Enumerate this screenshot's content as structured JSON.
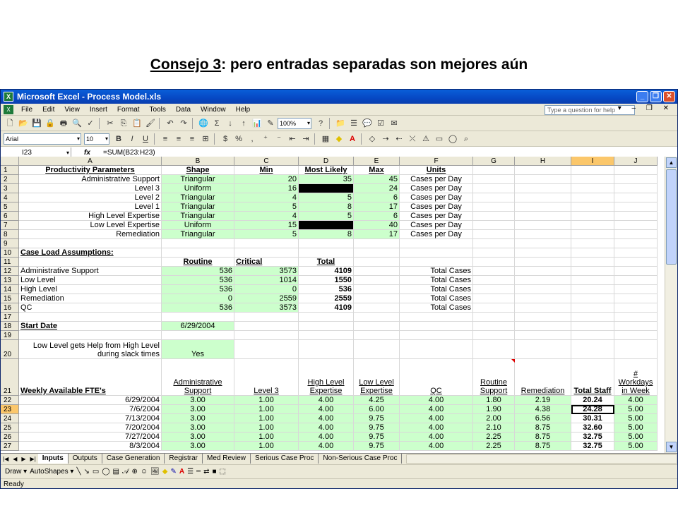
{
  "slide": {
    "title_underlined": "Consejo 3",
    "title_rest": ": pero entradas separadas son mejores aún"
  },
  "window": {
    "title": "Microsoft Excel - Process Model.xls"
  },
  "menu": [
    "File",
    "Edit",
    "View",
    "Insert",
    "Format",
    "Tools",
    "Data",
    "Window",
    "Help"
  ],
  "ask_placeholder": "Type a question for help",
  "toolbar": {
    "zoom": "100%",
    "font": "Arial",
    "size": "10"
  },
  "formula_bar": {
    "name_box": "I23",
    "fx": "fx",
    "formula": "=SUM(B23:H23)"
  },
  "columns": [
    {
      "name": "A",
      "w": 202
    },
    {
      "name": "B",
      "w": 103
    },
    {
      "name": "C",
      "w": 91
    },
    {
      "name": "D",
      "w": 78
    },
    {
      "name": "E",
      "w": 65
    },
    {
      "name": "F",
      "w": 104
    },
    {
      "name": "G",
      "w": 59
    },
    {
      "name": "H",
      "w": 80
    },
    {
      "name": "I",
      "w": 61
    },
    {
      "name": "J",
      "w": 61
    }
  ],
  "selected_col": "I",
  "rows": [
    {
      "n": "1",
      "h": 13,
      "cells": {
        "A": {
          "v": "Productivity Parameters",
          "a": "c",
          "s": "bu"
        },
        "B": {
          "v": "Shape",
          "a": "c",
          "s": "bu"
        },
        "C": {
          "v": "Min",
          "a": "c",
          "s": "bu"
        },
        "D": {
          "v": "Most Likely",
          "a": "c",
          "s": "bu"
        },
        "E": {
          "v": "Max",
          "a": "c",
          "s": "bu"
        },
        "F": {
          "v": "Units",
          "a": "c",
          "s": "bu"
        }
      }
    },
    {
      "n": "2",
      "h": 13,
      "cells": {
        "A": {
          "v": "Administrative Support",
          "a": "r"
        },
        "B": {
          "v": "Triangular",
          "a": "c",
          "g": 1
        },
        "C": {
          "v": "20",
          "a": "r",
          "g": 1
        },
        "D": {
          "v": "35",
          "a": "r",
          "g": 1
        },
        "E": {
          "v": "45",
          "a": "r",
          "g": 1
        },
        "F": {
          "v": "Cases per Day",
          "a": "c"
        }
      }
    },
    {
      "n": "3",
      "h": 13,
      "cells": {
        "A": {
          "v": "Level 3",
          "a": "r"
        },
        "B": {
          "v": "Uniform",
          "a": "c",
          "g": 1
        },
        "C": {
          "v": "16",
          "a": "r",
          "g": 1
        },
        "D": {
          "v": "",
          "k": 1
        },
        "E": {
          "v": "24",
          "a": "r",
          "g": 1
        },
        "F": {
          "v": "Cases per Day",
          "a": "c"
        }
      }
    },
    {
      "n": "4",
      "h": 13,
      "cells": {
        "A": {
          "v": "Level 2",
          "a": "r"
        },
        "B": {
          "v": "Triangular",
          "a": "c",
          "g": 1
        },
        "C": {
          "v": "4",
          "a": "r",
          "g": 1
        },
        "D": {
          "v": "5",
          "a": "r",
          "g": 1
        },
        "E": {
          "v": "6",
          "a": "r",
          "g": 1
        },
        "F": {
          "v": "Cases per Day",
          "a": "c"
        }
      }
    },
    {
      "n": "5",
      "h": 13,
      "cells": {
        "A": {
          "v": "Level 1",
          "a": "r"
        },
        "B": {
          "v": "Triangular",
          "a": "c",
          "g": 1
        },
        "C": {
          "v": "5",
          "a": "r",
          "g": 1
        },
        "D": {
          "v": "8",
          "a": "r",
          "g": 1
        },
        "E": {
          "v": "17",
          "a": "r",
          "g": 1
        },
        "F": {
          "v": "Cases per Day",
          "a": "c"
        }
      }
    },
    {
      "n": "6",
      "h": 13,
      "cells": {
        "A": {
          "v": "High Level Expertise",
          "a": "r"
        },
        "B": {
          "v": "Triangular",
          "a": "c",
          "g": 1
        },
        "C": {
          "v": "4",
          "a": "r",
          "g": 1
        },
        "D": {
          "v": "5",
          "a": "r",
          "g": 1
        },
        "E": {
          "v": "6",
          "a": "r",
          "g": 1
        },
        "F": {
          "v": "Cases per Day",
          "a": "c"
        }
      }
    },
    {
      "n": "7",
      "h": 13,
      "cells": {
        "A": {
          "v": "Low Level Expertise",
          "a": "r"
        },
        "B": {
          "v": "Uniform",
          "a": "c",
          "g": 1
        },
        "C": {
          "v": "15",
          "a": "r",
          "g": 1
        },
        "D": {
          "v": "",
          "k": 1
        },
        "E": {
          "v": "40",
          "a": "r",
          "g": 1
        },
        "F": {
          "v": "Cases per Day",
          "a": "c"
        }
      }
    },
    {
      "n": "8",
      "h": 13,
      "cells": {
        "A": {
          "v": "Remediation",
          "a": "r"
        },
        "B": {
          "v": "Triangular",
          "a": "c",
          "g": 1
        },
        "C": {
          "v": "5",
          "a": "r",
          "g": 1
        },
        "D": {
          "v": "8",
          "a": "r",
          "g": 1
        },
        "E": {
          "v": "17",
          "a": "r",
          "g": 1
        },
        "F": {
          "v": "Cases per Day",
          "a": "c"
        }
      }
    },
    {
      "n": "9",
      "h": 13,
      "cells": {}
    },
    {
      "n": "10",
      "h": 13,
      "cells": {
        "A": {
          "v": "Case Load Assumptions:",
          "a": "l",
          "s": "bu"
        }
      }
    },
    {
      "n": "11",
      "h": 13,
      "cells": {
        "B": {
          "v": "Routine",
          "a": "c",
          "s": "bu"
        },
        "C": {
          "v": "Critical",
          "a": "l",
          "s": "bu"
        },
        "D": {
          "v": "Total",
          "a": "c",
          "s": "bu"
        }
      }
    },
    {
      "n": "12",
      "h": 13,
      "cells": {
        "A": {
          "v": "Administrative Support",
          "a": "l"
        },
        "B": {
          "v": "536",
          "a": "r",
          "g": 1
        },
        "C": {
          "v": "3573",
          "a": "r",
          "g": 1
        },
        "D": {
          "v": "4109",
          "a": "r",
          "s": "b"
        },
        "F": {
          "v": "Total Cases",
          "a": "r"
        }
      }
    },
    {
      "n": "13",
      "h": 13,
      "cells": {
        "A": {
          "v": "Low Level",
          "a": "l"
        },
        "B": {
          "v": "536",
          "a": "r",
          "g": 1
        },
        "C": {
          "v": "1014",
          "a": "r",
          "g": 1
        },
        "D": {
          "v": "1550",
          "a": "r",
          "s": "b"
        },
        "F": {
          "v": "Total Cases",
          "a": "r"
        }
      }
    },
    {
      "n": "14",
      "h": 13,
      "cells": {
        "A": {
          "v": "High Level",
          "a": "l"
        },
        "B": {
          "v": "536",
          "a": "r",
          "g": 1
        },
        "C": {
          "v": "0",
          "a": "r",
          "g": 1
        },
        "D": {
          "v": "536",
          "a": "r",
          "s": "b"
        },
        "F": {
          "v": "Total Cases",
          "a": "r"
        }
      }
    },
    {
      "n": "15",
      "h": 13,
      "cells": {
        "A": {
          "v": "Remediation",
          "a": "l"
        },
        "B": {
          "v": "0",
          "a": "r",
          "g": 1
        },
        "C": {
          "v": "2559",
          "a": "r",
          "g": 1
        },
        "D": {
          "v": "2559",
          "a": "r",
          "s": "b"
        },
        "F": {
          "v": "Total Cases",
          "a": "r"
        }
      }
    },
    {
      "n": "16",
      "h": 13,
      "cells": {
        "A": {
          "v": "QC",
          "a": "l"
        },
        "B": {
          "v": "536",
          "a": "r",
          "g": 1
        },
        "C": {
          "v": "3573",
          "a": "r",
          "g": 1
        },
        "D": {
          "v": "4109",
          "a": "r",
          "s": "b"
        },
        "F": {
          "v": "Total Cases",
          "a": "r"
        }
      }
    },
    {
      "n": "17",
      "h": 13,
      "cells": {}
    },
    {
      "n": "18",
      "h": 13,
      "cells": {
        "A": {
          "v": "Start Date",
          "a": "l",
          "s": "bu"
        },
        "B": {
          "v": "6/29/2004",
          "a": "c",
          "g": 1
        }
      }
    },
    {
      "n": "19",
      "h": 13,
      "cells": {}
    },
    {
      "n": "20",
      "h": 27,
      "cells": {
        "A": {
          "v": "Low Level gets Help from High Level during slack times",
          "a": "r",
          "w": 1
        },
        "B": {
          "v": "Yes",
          "a": "c",
          "g": 1
        }
      }
    },
    {
      "n": "21",
      "h": 52,
      "cells": {
        "A": {
          "v": "Weekly Available FTE's",
          "a": "l",
          "s": "bu"
        },
        "B": {
          "v": "Administrative Support",
          "a": "c",
          "s": "u",
          "w": 1
        },
        "C": {
          "v": "Level 3",
          "a": "c",
          "s": "u"
        },
        "D": {
          "v": "High Level Expertise",
          "a": "c",
          "s": "u",
          "w": 1
        },
        "E": {
          "v": "Low Level Expertise",
          "a": "c",
          "s": "u",
          "w": 1
        },
        "F": {
          "v": "QC",
          "a": "c",
          "s": "u"
        },
        "G": {
          "v": "Routine Support",
          "a": "c",
          "s": "u",
          "w": 1
        },
        "H": {
          "v": "Remediation",
          "a": "c",
          "s": "u"
        },
        "I": {
          "v": "Total Staff",
          "a": "c",
          "s": "bu",
          "w": 1
        },
        "J": {
          "v": "# Workdays in Week",
          "a": "c",
          "s": "u",
          "w": 1
        }
      }
    },
    {
      "n": "22",
      "h": 13,
      "cells": {
        "A": {
          "v": "6/29/2004",
          "a": "r"
        },
        "B": {
          "v": "3.00",
          "a": "c",
          "g": 1
        },
        "C": {
          "v": "1.00",
          "a": "c",
          "g": 1
        },
        "D": {
          "v": "4.00",
          "a": "c",
          "g": 1
        },
        "E": {
          "v": "4.25",
          "a": "c",
          "g": 1
        },
        "F": {
          "v": "4.00",
          "a": "c",
          "g": 1
        },
        "G": {
          "v": "1.80",
          "a": "c",
          "g": 1
        },
        "H": {
          "v": "2.19",
          "a": "c",
          "g": 1
        },
        "I": {
          "v": "20.24",
          "a": "c",
          "s": "b"
        },
        "J": {
          "v": "4.00",
          "a": "c",
          "g": 1
        }
      }
    },
    {
      "n": "23",
      "h": 13,
      "sel": 1,
      "cells": {
        "A": {
          "v": "7/6/2004",
          "a": "r"
        },
        "B": {
          "v": "3.00",
          "a": "c",
          "g": 1
        },
        "C": {
          "v": "1.00",
          "a": "c",
          "g": 1
        },
        "D": {
          "v": "4.00",
          "a": "c",
          "g": 1
        },
        "E": {
          "v": "6.00",
          "a": "c",
          "g": 1
        },
        "F": {
          "v": "4.00",
          "a": "c",
          "g": 1
        },
        "G": {
          "v": "1.90",
          "a": "c",
          "g": 1
        },
        "H": {
          "v": "4.38",
          "a": "c",
          "g": 1
        },
        "I": {
          "v": "24.28",
          "a": "c",
          "s": "b",
          "box": 1
        },
        "J": {
          "v": "5.00",
          "a": "c",
          "g": 1
        }
      }
    },
    {
      "n": "24",
      "h": 13,
      "cells": {
        "A": {
          "v": "7/13/2004",
          "a": "r"
        },
        "B": {
          "v": "3.00",
          "a": "c",
          "g": 1
        },
        "C": {
          "v": "1.00",
          "a": "c",
          "g": 1
        },
        "D": {
          "v": "4.00",
          "a": "c",
          "g": 1
        },
        "E": {
          "v": "9.75",
          "a": "c",
          "g": 1
        },
        "F": {
          "v": "4.00",
          "a": "c",
          "g": 1
        },
        "G": {
          "v": "2.00",
          "a": "c",
          "g": 1
        },
        "H": {
          "v": "6.56",
          "a": "c",
          "g": 1
        },
        "I": {
          "v": "30.31",
          "a": "c",
          "s": "b"
        },
        "J": {
          "v": "5.00",
          "a": "c",
          "g": 1
        }
      }
    },
    {
      "n": "25",
      "h": 13,
      "cells": {
        "A": {
          "v": "7/20/2004",
          "a": "r"
        },
        "B": {
          "v": "3.00",
          "a": "c",
          "g": 1
        },
        "C": {
          "v": "1.00",
          "a": "c",
          "g": 1
        },
        "D": {
          "v": "4.00",
          "a": "c",
          "g": 1
        },
        "E": {
          "v": "9.75",
          "a": "c",
          "g": 1
        },
        "F": {
          "v": "4.00",
          "a": "c",
          "g": 1
        },
        "G": {
          "v": "2.10",
          "a": "c",
          "g": 1
        },
        "H": {
          "v": "8.75",
          "a": "c",
          "g": 1
        },
        "I": {
          "v": "32.60",
          "a": "c",
          "s": "b"
        },
        "J": {
          "v": "5.00",
          "a": "c",
          "g": 1
        }
      }
    },
    {
      "n": "26",
      "h": 13,
      "cells": {
        "A": {
          "v": "7/27/2004",
          "a": "r"
        },
        "B": {
          "v": "3.00",
          "a": "c",
          "g": 1
        },
        "C": {
          "v": "1.00",
          "a": "c",
          "g": 1
        },
        "D": {
          "v": "4.00",
          "a": "c",
          "g": 1
        },
        "E": {
          "v": "9.75",
          "a": "c",
          "g": 1
        },
        "F": {
          "v": "4.00",
          "a": "c",
          "g": 1
        },
        "G": {
          "v": "2.25",
          "a": "c",
          "g": 1
        },
        "H": {
          "v": "8.75",
          "a": "c",
          "g": 1
        },
        "I": {
          "v": "32.75",
          "a": "c",
          "s": "b"
        },
        "J": {
          "v": "5.00",
          "a": "c",
          "g": 1
        }
      }
    },
    {
      "n": "27",
      "h": 13,
      "cells": {
        "A": {
          "v": "8/3/2004",
          "a": "r"
        },
        "B": {
          "v": "3.00",
          "a": "c",
          "g": 1
        },
        "C": {
          "v": "1.00",
          "a": "c",
          "g": 1
        },
        "D": {
          "v": "4.00",
          "a": "c",
          "g": 1
        },
        "E": {
          "v": "9.75",
          "a": "c",
          "g": 1
        },
        "F": {
          "v": "4.00",
          "a": "c",
          "g": 1
        },
        "G": {
          "v": "2.25",
          "a": "c",
          "g": 1
        },
        "H": {
          "v": "8.75",
          "a": "c",
          "g": 1
        },
        "I": {
          "v": "32.75",
          "a": "c",
          "s": "b"
        },
        "J": {
          "v": "5.00",
          "a": "c",
          "g": 1
        }
      }
    }
  ],
  "sheet_tabs": [
    "Inputs",
    "Outputs",
    "Case Generation",
    "Registrar",
    "Med Review",
    "Serious Case Proc",
    "Non-Serious Case Proc"
  ],
  "active_tab": "Inputs",
  "drawbar": {
    "draw": "Draw ▾",
    "autoshapes": "AutoShapes ▾"
  },
  "status": "Ready",
  "colors": {
    "input_green": "#ccffcc",
    "selection": "#fbc76b",
    "title_blue": "#0a5fd8"
  }
}
